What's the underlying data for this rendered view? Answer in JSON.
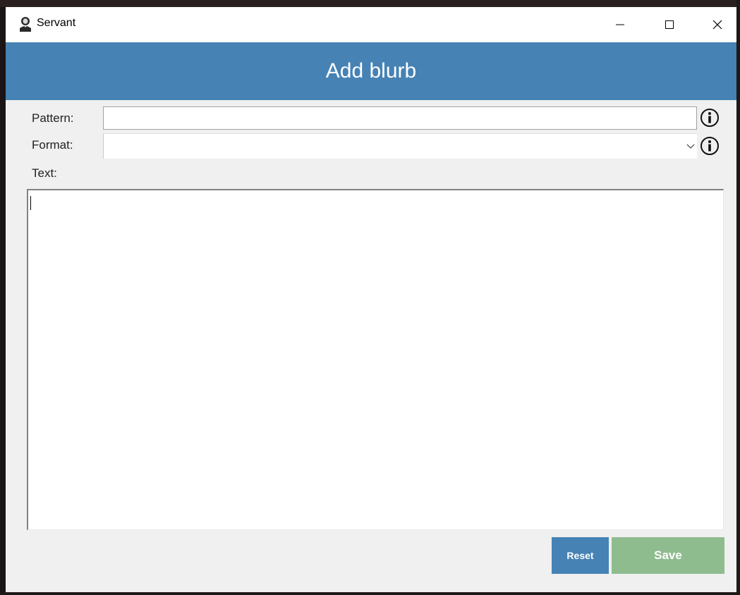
{
  "window": {
    "title": "Servant",
    "icon": "person-icon",
    "controls": [
      "minimize-icon",
      "maximize-icon",
      "close-icon"
    ]
  },
  "header": {
    "title": "Add blurb",
    "background": "#4682b4"
  },
  "form": {
    "pattern": {
      "label": "Pattern:",
      "value": "",
      "info_icon": "info-icon"
    },
    "format": {
      "label": "Format:",
      "value": "",
      "info_icon": "info-icon"
    },
    "text": {
      "label": "Text:",
      "value": ""
    }
  },
  "buttons": {
    "reset": {
      "label": "Reset",
      "color": "#4682b4"
    },
    "save": {
      "label": "Save",
      "color": "#8fbc8f"
    }
  }
}
